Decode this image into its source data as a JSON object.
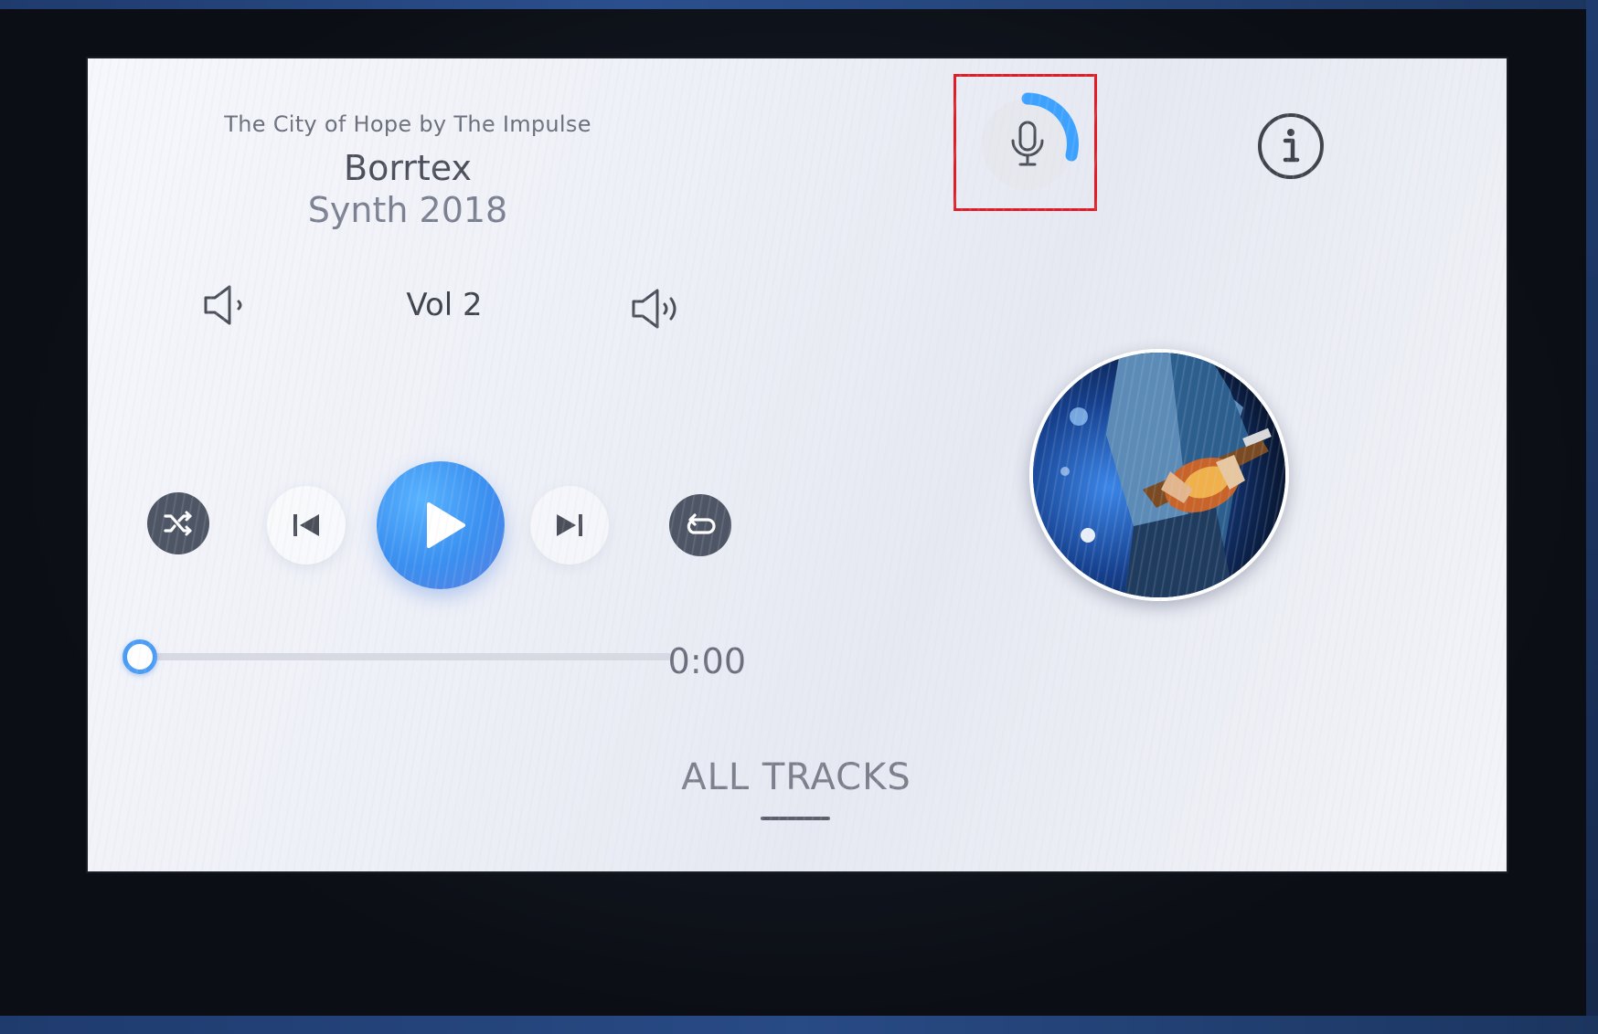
{
  "now_playing": {
    "album_line": "The City of Hope by The Impulse",
    "artist": "Borrtex",
    "track": "Synth 2018"
  },
  "volume": {
    "label": "Vol 2",
    "down_icon": "volume-down-icon",
    "up_icon": "volume-up-icon"
  },
  "controls": {
    "shuffle_icon": "shuffle-icon",
    "prev_icon": "skip-previous-icon",
    "play_icon": "play-icon",
    "next_icon": "skip-next-icon",
    "repeat_icon": "repeat-icon"
  },
  "progress": {
    "time": "0:00",
    "fraction": 0.0
  },
  "nav": {
    "all_tracks": "ALL TRACKS"
  },
  "top_actions": {
    "mic_icon": "microphone-icon",
    "info_icon": "info-icon"
  },
  "colors": {
    "accent": "#3a8ff0",
    "control_dark": "#4e5564",
    "highlight_box": "#e11c26"
  }
}
